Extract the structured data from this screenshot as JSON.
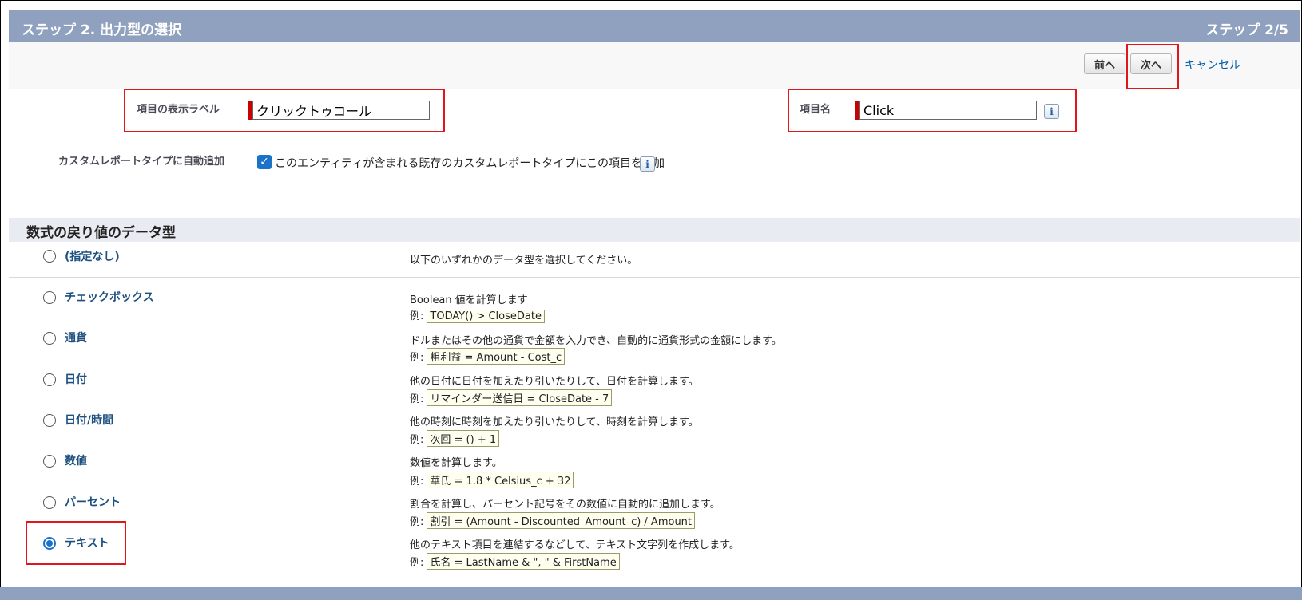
{
  "header": {
    "title": "ステップ 2. 出力型の選択",
    "step": "ステップ 2/5"
  },
  "toolbar": {
    "prev_label": "前へ",
    "next_label": "次へ",
    "cancel_label": "キャンセル"
  },
  "form": {
    "display_label": {
      "label": "項目の表示ラベル",
      "value": "クリックトゥコール"
    },
    "field_name": {
      "label": "項目名",
      "value": "Click"
    },
    "auto_add": {
      "label": "カスタムレポートタイプに自動追加",
      "checkbox_text": "このエンティティが含まれる既存のカスタムレポートタイプにこの項目を追加",
      "checked": true
    }
  },
  "section_title": "数式の戻り値のデータ型",
  "example_prefix": "例:",
  "types": [
    {
      "label": "(指定なし)",
      "desc": "以下のいずれかのデータ型を選択してください。",
      "example": "",
      "selected": false
    },
    {
      "label": "チェックボックス",
      "desc": "Boolean 値を計算します",
      "example": "TODAY() > CloseDate",
      "selected": false
    },
    {
      "label": "通貨",
      "desc": "ドルまたはその他の通貨で金額を入力でき、自動的に通貨形式の金額にします。",
      "example": "粗利益 = Amount - Cost_c",
      "selected": false
    },
    {
      "label": "日付",
      "desc": "他の日付に日付を加えたり引いたりして、日付を計算します。",
      "example": "リマインダー送信日 = CloseDate - 7",
      "selected": false
    },
    {
      "label": "日付/時間",
      "desc": "他の時刻に時刻を加えたり引いたりして、時刻を計算します。",
      "example": "次回 = () + 1",
      "selected": false
    },
    {
      "label": "数値",
      "desc": "数値を計算します。",
      "example": "華氏 = 1.8 * Celsius_c + 32",
      "selected": false
    },
    {
      "label": "パーセント",
      "desc": "割合を計算し、パーセント記号をその数値に自動的に追加します。",
      "example": "割引 = (Amount - Discounted_Amount_c) / Amount",
      "selected": false
    },
    {
      "label": "テキスト",
      "desc": "他のテキスト項目を連結するなどして、テキスト文字列を作成します。",
      "example": "氏名 = LastName & \", \" & FirstName",
      "selected": true
    }
  ],
  "colors": {
    "header": "#8fa1bf",
    "accent": "#1a73c9",
    "highlight": "#e0161b"
  }
}
